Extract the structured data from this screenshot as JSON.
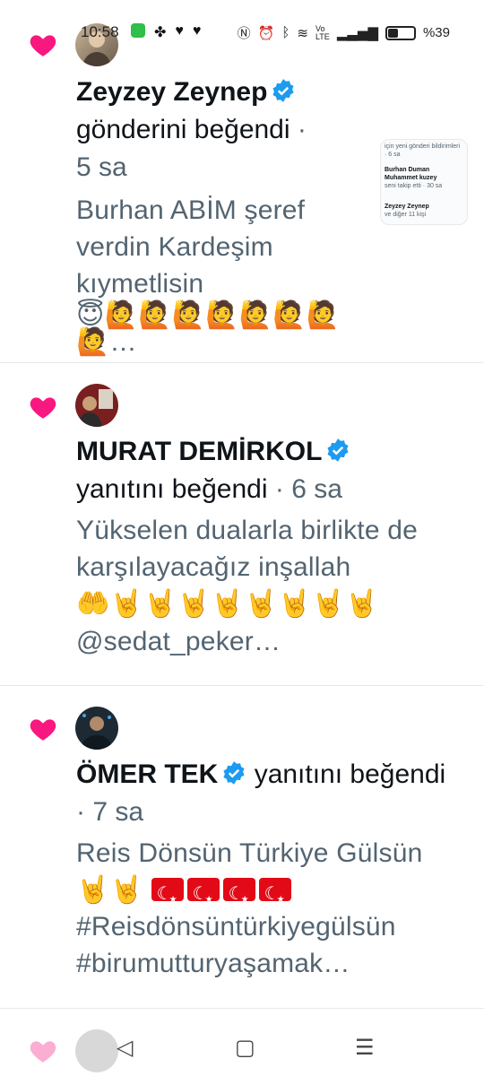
{
  "status_bar": {
    "time": "10:58",
    "battery": "%39",
    "battery_level": 0.39,
    "left_icons": [
      "phone-icon",
      "app-icon",
      "heart-icon",
      "heart-icon"
    ],
    "right_icons": [
      "nfc-icon",
      "alarm-icon",
      "bluetooth-icon",
      "wifi-icon",
      "volte-icon",
      "signal-icon"
    ]
  },
  "notifications": [
    {
      "user": "Zeyzey Zeynep",
      "verified": true,
      "action": "gönderini beğendi",
      "time": "5 sa",
      "text": "Burhan ABİM şeref verdin Kardeşim kıymetlisin",
      "emojis": "😇🙋🙋🙋🙋🙋🙋🙋🙋…",
      "thumbnail": {
        "line1": "için yeni gönderi bildirimleri · 6 sa",
        "line2": "Burhan Duman",
        "line3": "Muhammet kuzey",
        "line4": "seni takip etti · 30 sa",
        "line5": "Zeyzey Zeynep",
        "line6": "ve diğer 11 kişi"
      }
    },
    {
      "user": "MURAT DEMİRKOL",
      "verified": true,
      "action": "yanıtını beğendi",
      "time": "6 sa",
      "text": "Yükselen dualarla birlikte de karşılayacağız inşallah",
      "emojis": "🤲🤘🤘🤘🤘🤘🤘🤘🤘",
      "mention": "@sedat_peker…"
    },
    {
      "user": "ÖMER TEK",
      "verified": true,
      "action": "yanıtını beğendi",
      "time": "7 sa",
      "text": "Reis Dönsün Türkiye Gülsün",
      "emojis": "🤘🤘",
      "hashtag1": "#Reisdönsüntürkiyegülsün",
      "hashtag2": "#birumutturyaşamak…"
    }
  ],
  "nav": {
    "back": "◁",
    "home": "▢",
    "menu": "☰"
  },
  "colors": {
    "heart": "#f91880",
    "verified": "#1d9bf0",
    "secondary_text": "#536471",
    "flag": "#e30a17"
  }
}
